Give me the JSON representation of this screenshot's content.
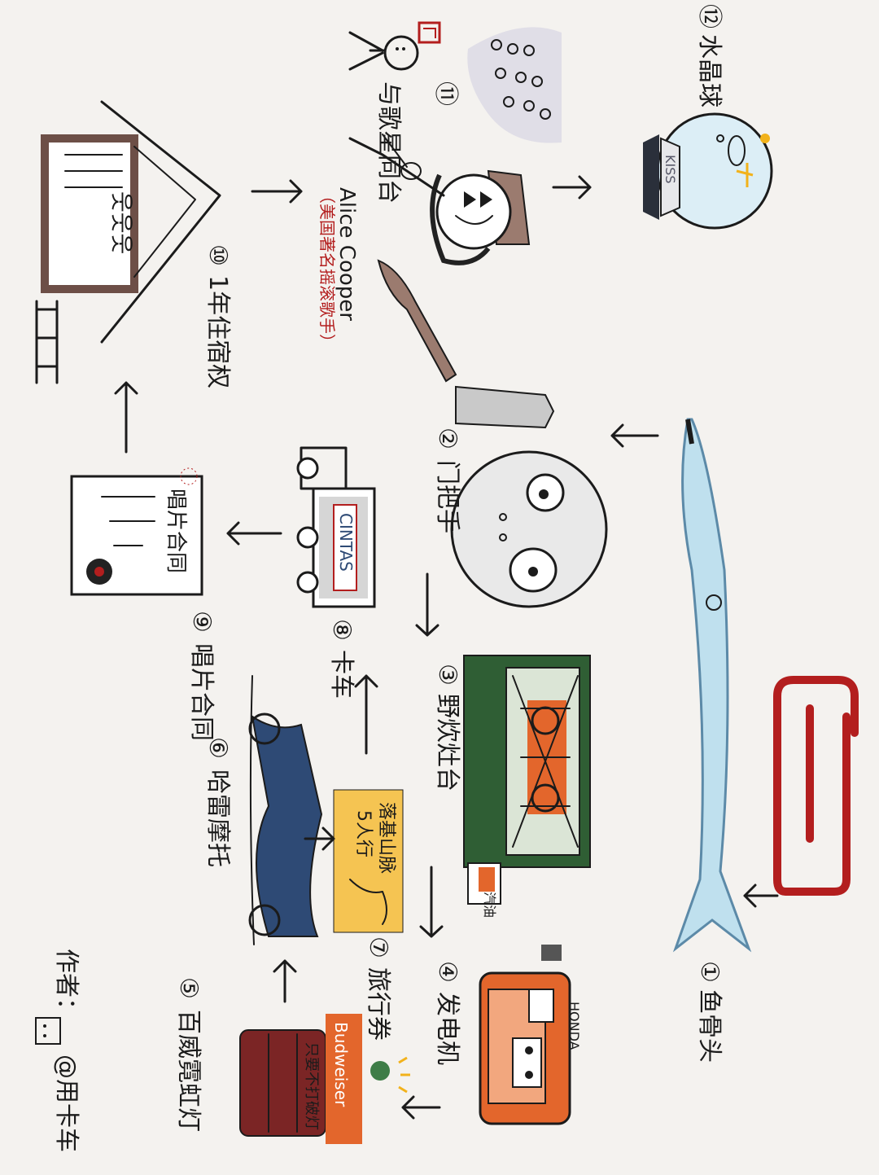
{
  "items": [
    {
      "id": "1",
      "number": "①",
      "text": "鱼骨头"
    },
    {
      "id": "2",
      "number": "②",
      "text": "门把手"
    },
    {
      "id": "3",
      "number": "③",
      "text": "野炊灶台"
    },
    {
      "id": "4",
      "number": "④",
      "text": "发电机"
    },
    {
      "id": "5",
      "number": "⑤",
      "text": "百威霓虹灯"
    },
    {
      "id": "6",
      "number": "⑥",
      "text": "哈雷摩托"
    },
    {
      "id": "7",
      "number": "⑦",
      "text": "旅行券"
    },
    {
      "id": "8",
      "number": "⑧",
      "text": "卡车"
    },
    {
      "id": "9",
      "number": "⑨",
      "text": "唱片合同"
    },
    {
      "id": "10",
      "number": "⑩",
      "text": "1年住宿权"
    },
    {
      "id": "11",
      "number": "⑪",
      "text": "与歌星同台"
    },
    {
      "id": "12",
      "number": "⑫",
      "text": "水晶球"
    }
  ],
  "alice": {
    "name": "Alice Cooper",
    "note": "（美国著名摇滚歌手）"
  },
  "drawing_labels": {
    "cintas": "CINTAS",
    "contract": "唱片合同",
    "ticket_line1": "落基山脉",
    "ticket_line2": "5人行",
    "fuel": "汽油",
    "neon_brand": "Budweiser",
    "neon_sub": "只要不打破灯",
    "generator_brand": "HONDA",
    "crystal_ball_brand": "KISS"
  },
  "author": {
    "label": "作者：",
    "signature": "@用卡车"
  },
  "colors": {
    "ink": "#1b1b1b",
    "red": "#b31e1e",
    "orange": "#e3662c",
    "green": "#2f5e34",
    "navy": "#2e4a75",
    "yellow": "#f5c452",
    "blue": "#bfe0ee",
    "brown": "#6d4f47"
  }
}
